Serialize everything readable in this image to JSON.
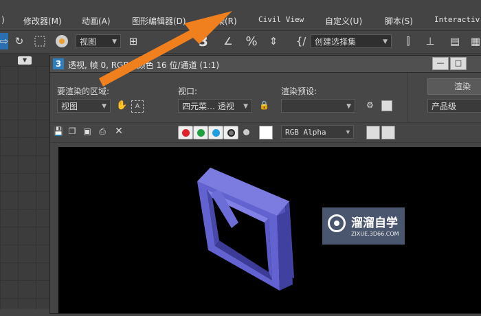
{
  "menu": {
    "items": [
      {
        "label": ")"
      },
      {
        "label": "修改器(M)"
      },
      {
        "label": "动画(A)"
      },
      {
        "label": "图形编辑器(D)"
      },
      {
        "label": "渲染(R)"
      },
      {
        "label": "Civil View"
      },
      {
        "label": "自定义(U)"
      },
      {
        "label": "脚本(S)"
      },
      {
        "label": "Interactiv"
      }
    ]
  },
  "toolbar": {
    "view_dropdown": "视图",
    "selection_set_dropdown": "创建选择集",
    "snap_3": "3"
  },
  "frame_window": {
    "title": "透视, 帧 0, RGBA 颜色 16 位/通道 (1:1)",
    "title_icon": "3",
    "area_label": "要渲染的区域:",
    "area_value": "视图",
    "viewport_label": "视口:",
    "viewport_value": "四元菜… 透视",
    "preset_label": "渲染预设:",
    "preset_value": "",
    "render_button": "渲染",
    "production_dropdown": "产品级",
    "channel_dropdown": "RGB Alpha"
  },
  "watermark": {
    "text": "溜溜自学",
    "url": "ZIXUE.3D66.COM"
  },
  "colors": {
    "arrow": "#f07f1e",
    "window_frame": "#5a5ac8",
    "red": "#e0202a",
    "green": "#20a040",
    "blue": "#1e9ee0"
  }
}
